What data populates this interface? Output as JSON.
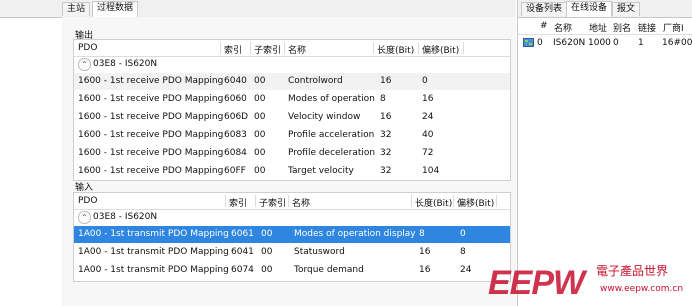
{
  "left_tabs": [
    {
      "label": "主站",
      "active": false
    },
    {
      "label": "过程数据",
      "active": true
    }
  ],
  "right_tabs": [
    {
      "label": "设备列表",
      "active": false
    },
    {
      "label": "在线设备",
      "active": true
    },
    {
      "label": "报文",
      "active": false
    }
  ],
  "output": {
    "section_label": "输出",
    "headers": [
      "PDO",
      "索引",
      "子索引",
      "名称",
      "长度(Bit)",
      "偏移(Bit)"
    ],
    "group": "03E8 - IS620N",
    "rows": [
      {
        "pdo": "1600 - 1st receive PDO Mapping",
        "index": "6040",
        "sub": "00",
        "name": "Controlword",
        "len": "16",
        "off": "0"
      },
      {
        "pdo": "1600 - 1st receive PDO Mapping",
        "index": "6060",
        "sub": "00",
        "name": "Modes of operation",
        "len": "8",
        "off": "16"
      },
      {
        "pdo": "1600 - 1st receive PDO Mapping",
        "index": "606D",
        "sub": "00",
        "name": "Velocity window",
        "len": "16",
        "off": "24"
      },
      {
        "pdo": "1600 - 1st receive PDO Mapping",
        "index": "6083",
        "sub": "00",
        "name": "Profile acceleration",
        "len": "32",
        "off": "40"
      },
      {
        "pdo": "1600 - 1st receive PDO Mapping",
        "index": "6084",
        "sub": "00",
        "name": "Profile deceleration",
        "len": "32",
        "off": "72"
      },
      {
        "pdo": "1600 - 1st receive PDO Mapping",
        "index": "60FF",
        "sub": "00",
        "name": "Target velocity",
        "len": "32",
        "off": "104"
      }
    ]
  },
  "input": {
    "section_label": "输入",
    "headers": [
      "PDO",
      "索引",
      "子索引",
      "名称",
      "长度(Bit)",
      "偏移(Bit)"
    ],
    "group": "03E8 - IS620N",
    "rows": [
      {
        "pdo": "1A00 - 1st transmit PDO Mapping",
        "index": "6061",
        "sub": "00",
        "name": "Modes of operation display",
        "len": "8",
        "off": "0",
        "selected": true
      },
      {
        "pdo": "1A00 - 1st transmit PDO Mapping",
        "index": "6041",
        "sub": "00",
        "name": "Statusword",
        "len": "16",
        "off": "8",
        "selected": false
      },
      {
        "pdo": "1A00 - 1st transmit PDO Mapping",
        "index": "6074",
        "sub": "00",
        "name": "Torque demand",
        "len": "16",
        "off": "24",
        "selected": false
      }
    ]
  },
  "devices": {
    "headers": [
      "#",
      "名称",
      "地址",
      "别名",
      "链接",
      "厂商I"
    ],
    "rows": [
      {
        "num": "0",
        "name": "IS620N",
        "addr": "1000",
        "alias": "0",
        "link": "1",
        "vendor": "16#00"
      }
    ]
  },
  "watermark": {
    "logo": "EEPW",
    "tagline": "電子產品世界",
    "url": "www.eepw.com.cn"
  },
  "colors": {
    "selection": "#2f86e0",
    "watermark_red": "#c8102e"
  }
}
